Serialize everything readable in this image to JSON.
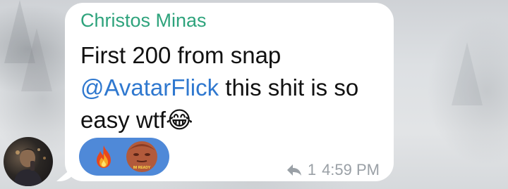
{
  "message": {
    "sender_name": "Christos Minas",
    "text_before_mention": "First 200 from snap",
    "mention": "@AvatarFlick",
    "text_after_mention": " this shit is so easy wtf",
    "emoji": "😂"
  },
  "reactions": [
    {
      "type": "emoji",
      "value": "🔥"
    },
    {
      "type": "sticker",
      "value": "IM READY"
    }
  ],
  "meta": {
    "reply_count": "1",
    "time": "4:59 PM",
    "icon": "reply-icon"
  },
  "colors": {
    "sender": "#2ea37c",
    "mention": "#2f78cf",
    "reaction_pill": "#4f89d8",
    "meta": "#9aa0a6"
  }
}
